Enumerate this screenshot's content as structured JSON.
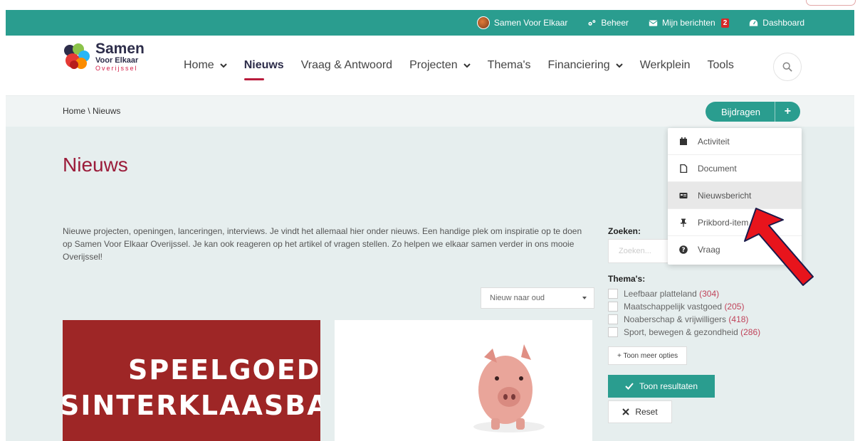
{
  "utility": {
    "profile_label": "Samen Voor Elkaar",
    "beheer_label": "Beheer",
    "berichten_label": "Mijn berichten",
    "berichten_count": "2",
    "dashboard_label": "Dashboard"
  },
  "logo": {
    "line1": "Samen",
    "line2": "Voor Elkaar",
    "line3": "Overijssel"
  },
  "nav": {
    "items": [
      {
        "label": "Home",
        "has_dropdown": true,
        "active": false
      },
      {
        "label": "Nieuws",
        "has_dropdown": false,
        "active": true
      },
      {
        "label": "Vraag & Antwoord",
        "has_dropdown": false,
        "active": false
      },
      {
        "label": "Projecten",
        "has_dropdown": true,
        "active": false
      },
      {
        "label": "Thema's",
        "has_dropdown": false,
        "active": false
      },
      {
        "label": "Financiering",
        "has_dropdown": true,
        "active": false
      },
      {
        "label": "Werkplein",
        "has_dropdown": false,
        "active": false
      },
      {
        "label": "Tools",
        "has_dropdown": false,
        "active": false
      }
    ]
  },
  "breadcrumb": {
    "text": "Home \\ Nieuws"
  },
  "bijdragen": {
    "label": "Bijdragen",
    "plus": "+"
  },
  "dropdown": {
    "items": [
      {
        "label": "Activiteit",
        "icon": "calendar-icon"
      },
      {
        "label": "Document",
        "icon": "document-icon"
      },
      {
        "label": "Nieuwsbericht",
        "icon": "newspaper-icon",
        "highlighted": true
      },
      {
        "label": "Prikbord-item",
        "icon": "pin-icon"
      },
      {
        "label": "Vraag",
        "icon": "question-icon"
      }
    ]
  },
  "main": {
    "title": "Nieuws",
    "intro": "Nieuwe projecten, openingen, lanceringen, interviews. Je vindt het allemaal hier onder nieuws. Een handige plek om inspiratie op te doen op Samen Voor Elkaar Overijssel. Je kan ook reageren op het artikel of vragen stellen. Zo helpen we elkaar samen verder in ons mooie Overijssel!",
    "sort_value": "Nieuw naar oud",
    "card1_line1": "SPEELGOED",
    "card1_line2": "SINTERKLAASBANK"
  },
  "filters": {
    "zoeken_label": "Zoeken:",
    "zoeken_placeholder": "Zoeken...",
    "themas_label": "Thema's:",
    "themas": [
      {
        "label": "Leefbaar platteland",
        "count": "(304)"
      },
      {
        "label": "Maatschappelijk vastgoed",
        "count": "(205)"
      },
      {
        "label": "Noaberschap & vrijwilligers",
        "count": "(418)"
      },
      {
        "label": "Sport, bewegen & gezondheid",
        "count": "(286)"
      }
    ],
    "meer_label": "+ Toon meer opties",
    "toon_label": "Toon resultaten",
    "reset_label": "Reset"
  },
  "colors": {
    "teal": "#2a9d8f",
    "title_red": "#9b1c3a",
    "annotation_arrow": "#e8141c"
  }
}
